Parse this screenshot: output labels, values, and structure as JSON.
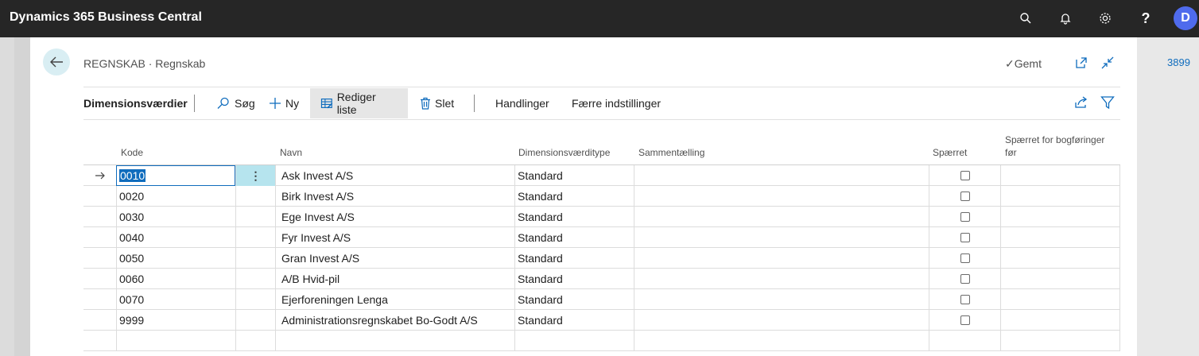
{
  "app": {
    "title": "Dynamics 365 Business Central",
    "avatar_initial": "D"
  },
  "top_icons": [
    "search-icon",
    "bell-icon",
    "gear-icon",
    "help-icon"
  ],
  "header": {
    "breadcrumb": "REGNSKAB · Regnskab",
    "saved_label": "Gemt",
    "side_number": "3899"
  },
  "actionbar": {
    "title": "Dimensionsværdier",
    "search": "Søg",
    "new": "Ny",
    "edit_list": "Rediger liste",
    "delete": "Slet",
    "actions": "Handlinger",
    "fewer_options": "Færre indstillinger"
  },
  "table": {
    "columns": {
      "code": "Kode",
      "name": "Navn",
      "type": "Dimensionsværditype",
      "totaling": "Sammentælling",
      "blocked": "Spærret",
      "blocked_posting_1": "Spærret for bogføringer",
      "blocked_posting_2": "før"
    },
    "rows": [
      {
        "code": "0010",
        "name": "Ask Invest A/S",
        "type": "Standard",
        "totaling": "",
        "blocked": false
      },
      {
        "code": "0020",
        "name": "Birk Invest A/S",
        "type": "Standard",
        "totaling": "",
        "blocked": false
      },
      {
        "code": "0030",
        "name": "Ege Invest A/S",
        "type": "Standard",
        "totaling": "",
        "blocked": false
      },
      {
        "code": "0040",
        "name": "Fyr Invest A/S",
        "type": "Standard",
        "totaling": "",
        "blocked": false
      },
      {
        "code": "0050",
        "name": "Gran Invest A/S",
        "type": "Standard",
        "totaling": "",
        "blocked": false
      },
      {
        "code": "0060",
        "name": "A/B Hvid-pil",
        "type": "Standard",
        "totaling": "",
        "blocked": false
      },
      {
        "code": "0070",
        "name": "Ejerforeningen Lenga",
        "type": "Standard",
        "totaling": "",
        "blocked": false
      },
      {
        "code": "9999",
        "name": "Administrationsregnskabet Bo-Godt A/S",
        "type": "Standard",
        "totaling": "",
        "blocked": false
      }
    ]
  },
  "colors": {
    "topbar": "#262626",
    "accent": "#0f6cbd",
    "avatar": "#4f6bed",
    "selection_menu": "#b6e4ee"
  }
}
